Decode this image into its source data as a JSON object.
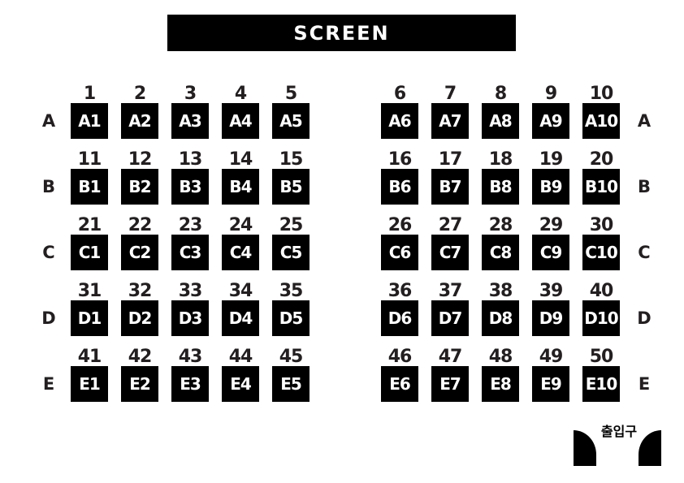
{
  "screen_label": "SCREEN",
  "exit_label": "출입구",
  "rows": [
    {
      "label": "A",
      "seats": [
        {
          "num": "1",
          "name": "A1"
        },
        {
          "num": "2",
          "name": "A2"
        },
        {
          "num": "3",
          "name": "A3"
        },
        {
          "num": "4",
          "name": "A4"
        },
        {
          "num": "5",
          "name": "A5"
        },
        {
          "num": "6",
          "name": "A6"
        },
        {
          "num": "7",
          "name": "A7"
        },
        {
          "num": "8",
          "name": "A8"
        },
        {
          "num": "9",
          "name": "A9"
        },
        {
          "num": "10",
          "name": "A10"
        }
      ]
    },
    {
      "label": "B",
      "seats": [
        {
          "num": "11",
          "name": "B1"
        },
        {
          "num": "12",
          "name": "B2"
        },
        {
          "num": "13",
          "name": "B3"
        },
        {
          "num": "14",
          "name": "B4"
        },
        {
          "num": "15",
          "name": "B5"
        },
        {
          "num": "16",
          "name": "B6"
        },
        {
          "num": "17",
          "name": "B7"
        },
        {
          "num": "18",
          "name": "B8"
        },
        {
          "num": "19",
          "name": "B9"
        },
        {
          "num": "20",
          "name": "B10"
        }
      ]
    },
    {
      "label": "C",
      "seats": [
        {
          "num": "21",
          "name": "C1"
        },
        {
          "num": "22",
          "name": "C2"
        },
        {
          "num": "23",
          "name": "C3"
        },
        {
          "num": "24",
          "name": "C4"
        },
        {
          "num": "25",
          "name": "C5"
        },
        {
          "num": "26",
          "name": "C6"
        },
        {
          "num": "27",
          "name": "C7"
        },
        {
          "num": "28",
          "name": "C8"
        },
        {
          "num": "29",
          "name": "C9"
        },
        {
          "num": "30",
          "name": "C10"
        }
      ]
    },
    {
      "label": "D",
      "seats": [
        {
          "num": "31",
          "name": "D1"
        },
        {
          "num": "32",
          "name": "D2"
        },
        {
          "num": "33",
          "name": "D3"
        },
        {
          "num": "34",
          "name": "D4"
        },
        {
          "num": "35",
          "name": "D5"
        },
        {
          "num": "36",
          "name": "D6"
        },
        {
          "num": "37",
          "name": "D7"
        },
        {
          "num": "38",
          "name": "D8"
        },
        {
          "num": "39",
          "name": "D9"
        },
        {
          "num": "40",
          "name": "D10"
        }
      ]
    },
    {
      "label": "E",
      "seats": [
        {
          "num": "41",
          "name": "E1"
        },
        {
          "num": "42",
          "name": "E2"
        },
        {
          "num": "43",
          "name": "E3"
        },
        {
          "num": "44",
          "name": "E4"
        },
        {
          "num": "45",
          "name": "E5"
        },
        {
          "num": "46",
          "name": "E6"
        },
        {
          "num": "47",
          "name": "E7"
        },
        {
          "num": "48",
          "name": "E8"
        },
        {
          "num": "49",
          "name": "E9"
        },
        {
          "num": "50",
          "name": "E10"
        }
      ]
    }
  ]
}
